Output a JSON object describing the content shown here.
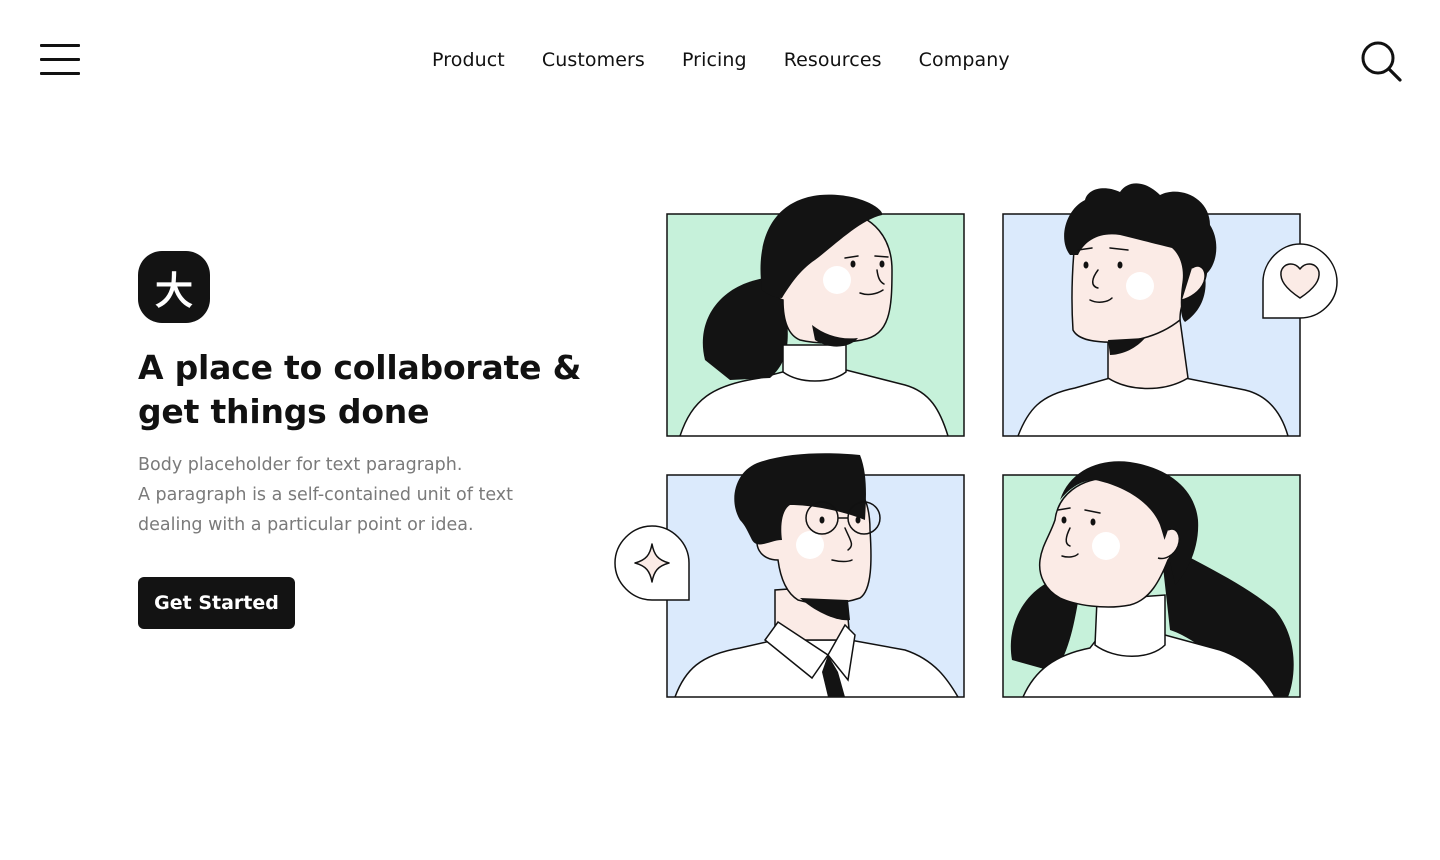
{
  "header": {
    "menu_icon": "hamburger-menu-icon",
    "nav": [
      {
        "label": "Product"
      },
      {
        "label": "Customers"
      },
      {
        "label": "Pricing"
      },
      {
        "label": "Resources"
      },
      {
        "label": "Company"
      }
    ],
    "search_icon": "search-icon"
  },
  "hero": {
    "logo_glyph": "大",
    "headline_line1": "A place to collaborate &",
    "headline_line2": "get things done",
    "body_line1": "Body placeholder for text paragraph.",
    "body_line2": "A paragraph is a self-contained unit of text",
    "body_line3": "dealing with a particular point or idea.",
    "cta_label": "Get Started"
  },
  "illustration": {
    "tiles": [
      {
        "name": "woman-ponytail",
        "bg": "#c6f1da"
      },
      {
        "name": "man-curly-hair",
        "bg": "#dbeafc"
      },
      {
        "name": "man-glasses-tie",
        "bg": "#dbeafc"
      },
      {
        "name": "woman-long-hair",
        "bg": "#c6f1da"
      }
    ],
    "bubbles": [
      "heart-icon",
      "sparkle-icon"
    ],
    "colors": {
      "skin": "#fbebe6",
      "hair": "#131313",
      "cheek": "#ffffff"
    }
  }
}
